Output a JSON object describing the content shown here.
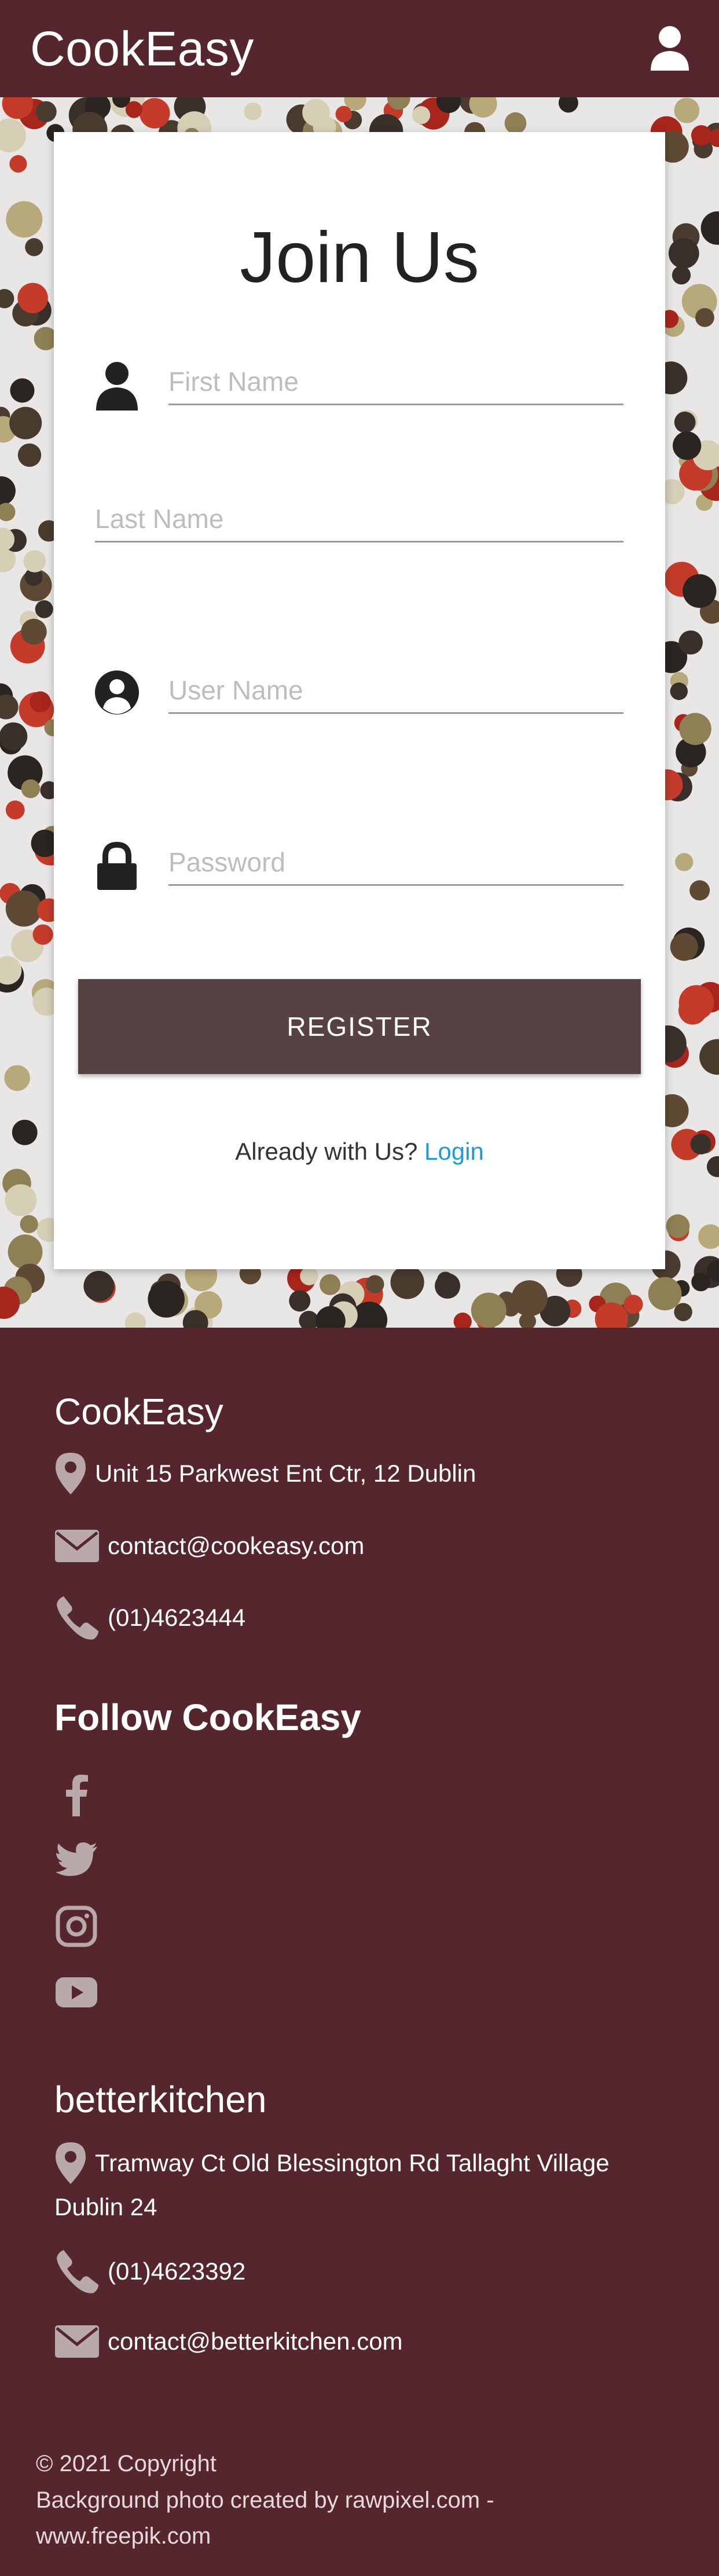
{
  "navbar": {
    "brand": "CookEasy",
    "account_icon": "user-icon"
  },
  "register_form": {
    "title": "Join Us",
    "first_name_placeholder": "First Name",
    "last_name_placeholder": "Last Name",
    "user_name_placeholder": "User Name",
    "password_placeholder": "Password",
    "register_label": "REGISTER",
    "already_text": "Already with Us?",
    "login_label": "Login"
  },
  "footer": {
    "cookeasy": {
      "title": "CookEasy",
      "address": "Unit 15 Parkwest Ent Ctr, 12 Dublin",
      "email": "contact@cookeasy.com",
      "phone": "(01)4623444"
    },
    "follow": {
      "title": "Follow CookEasy",
      "icons": [
        "facebook-icon",
        "twitter-icon",
        "instagram-icon",
        "youtube-icon"
      ]
    },
    "betterkitchen": {
      "title": "betterkitchen",
      "address_line1": "Tramway Ct Old Blessington Rd Tallaght Village",
      "address_line2": "Dublin 24",
      "phone": "(01)4623392",
      "email": "contact@betterkitchen.com"
    },
    "copyright": "© 2021 Copyright",
    "credit_line1": "Background photo created by rawpixel.com -",
    "credit_line2": "www.freepik.com"
  },
  "colors": {
    "primary": "#55262e",
    "button": "#574142",
    "link": "#1e9bd7"
  }
}
